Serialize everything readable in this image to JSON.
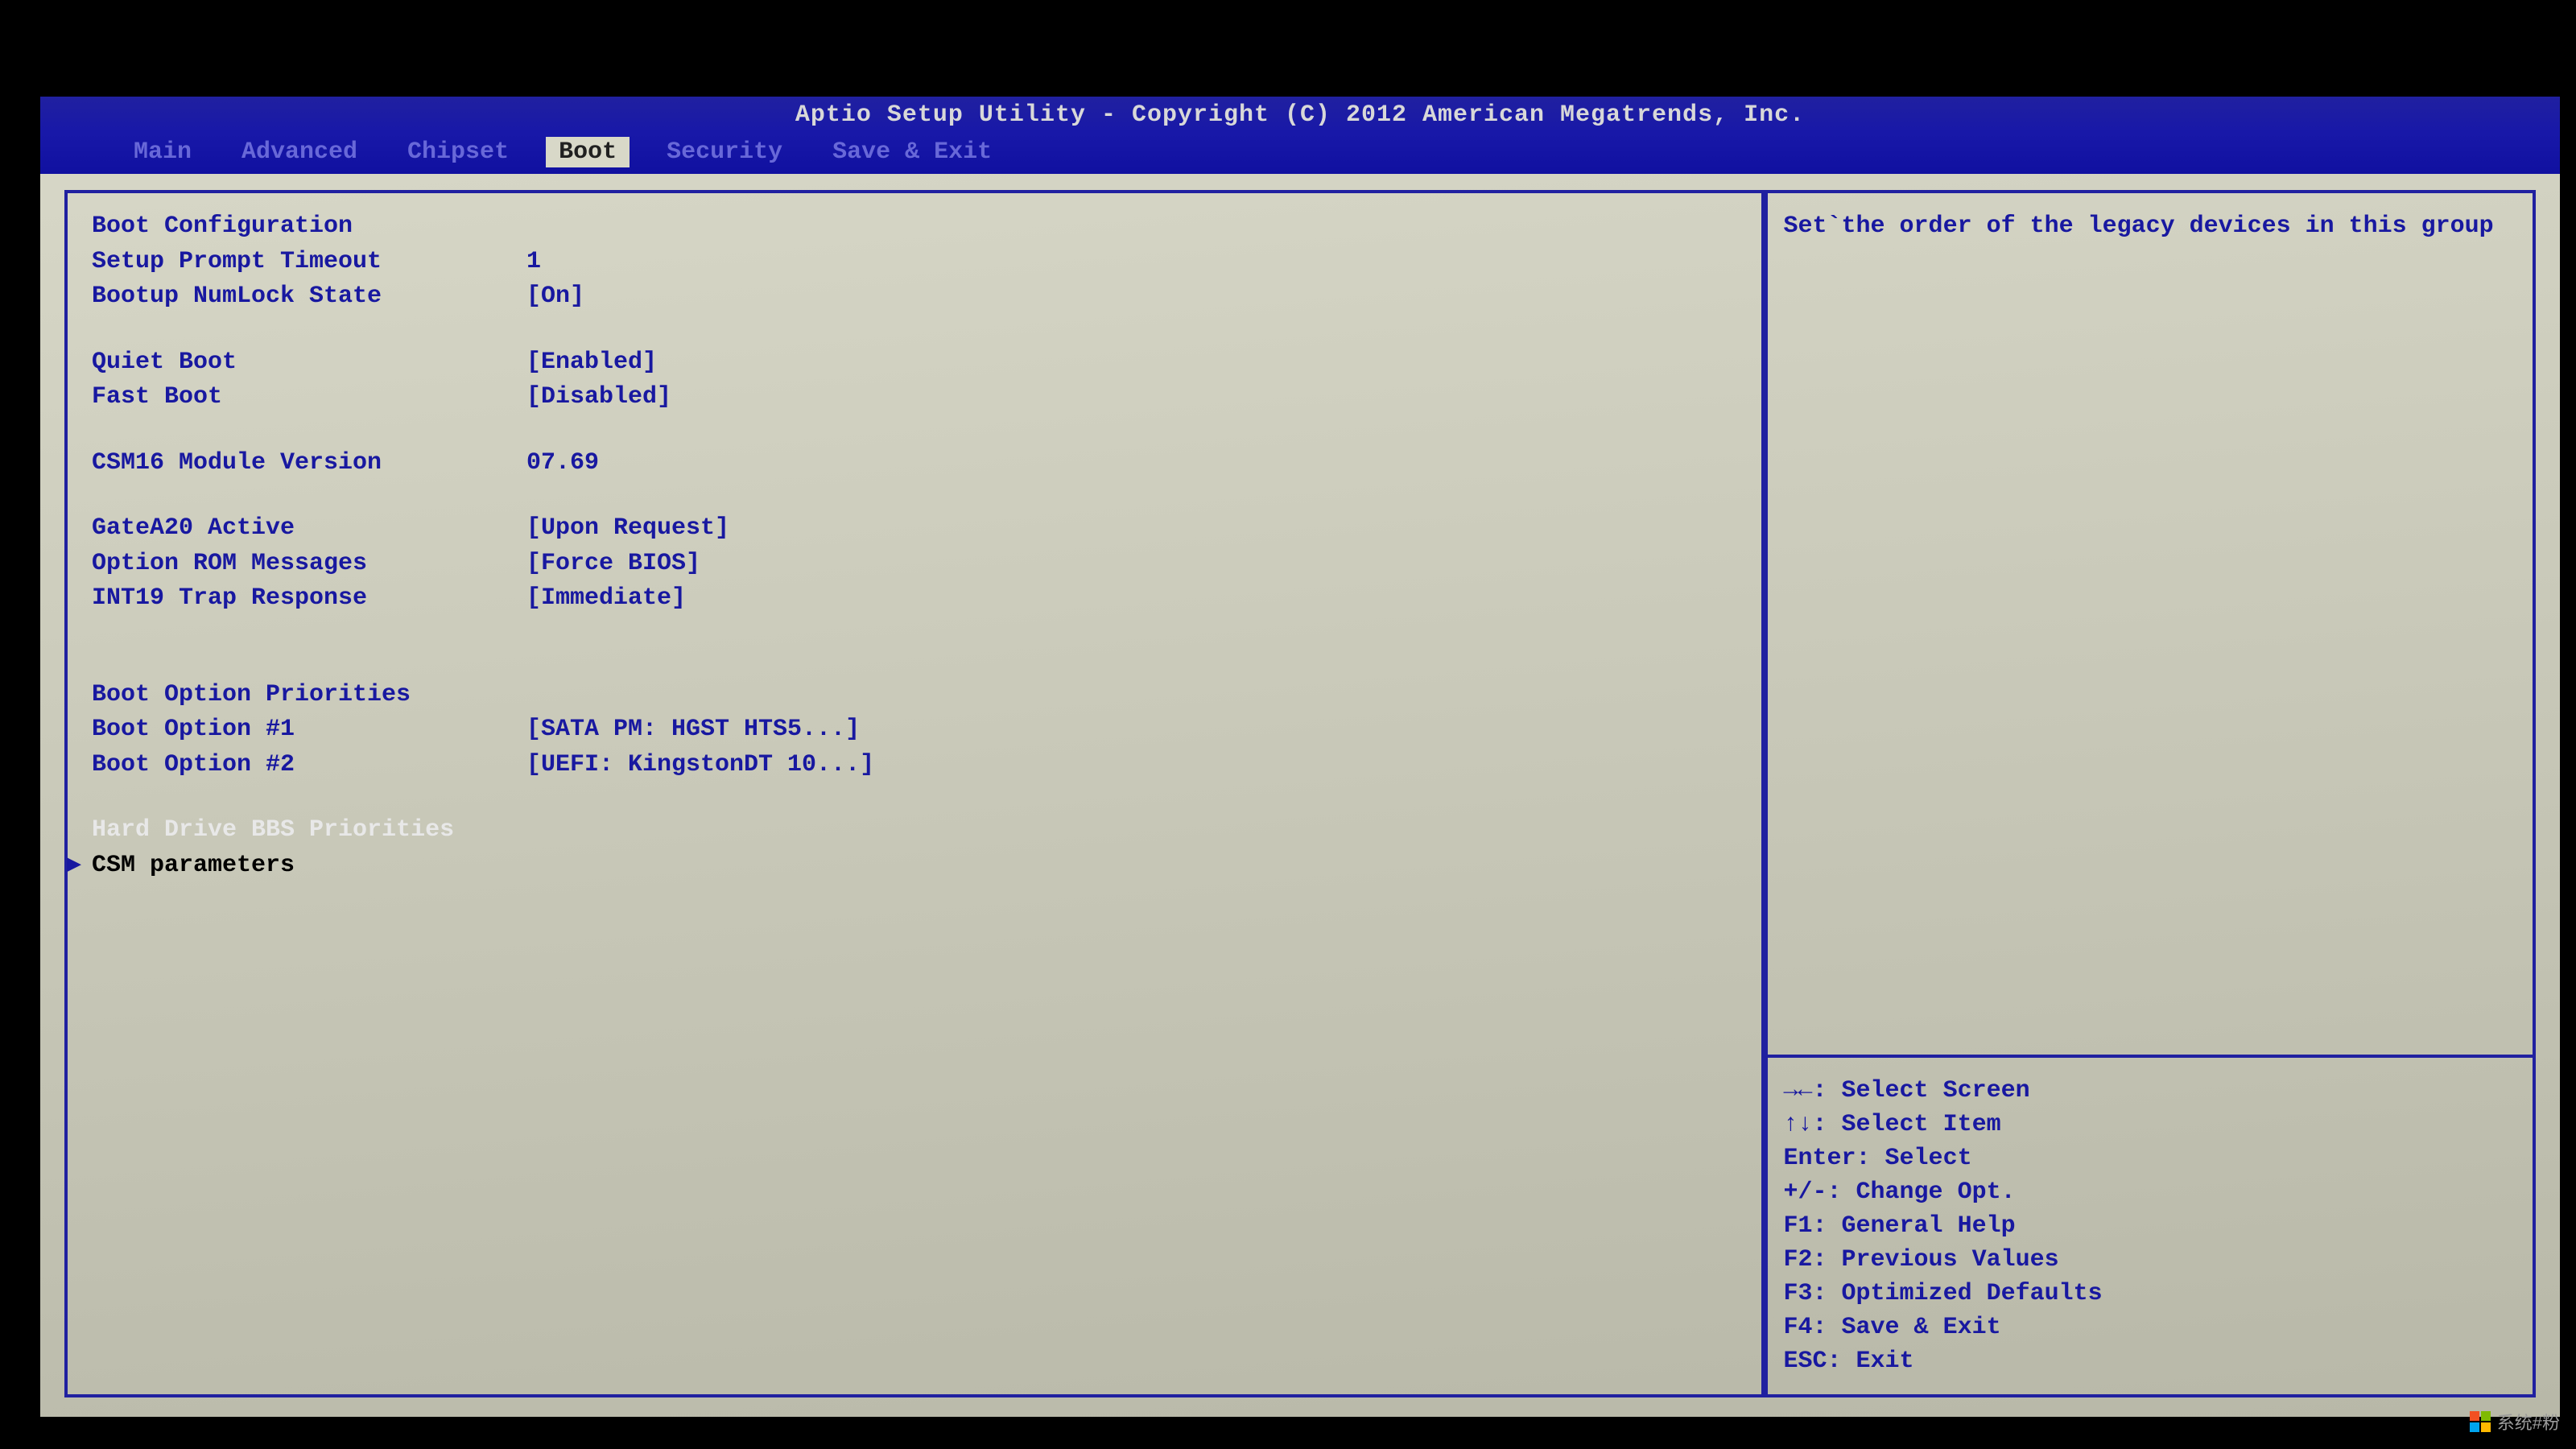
{
  "title": "Aptio Setup Utility - Copyright (C) 2012 American Megatrends, Inc.",
  "tabs": {
    "main": "Main",
    "advanced": "Advanced",
    "chipset": "Chipset",
    "boot": "Boot",
    "security": "Security",
    "save_exit": "Save & Exit"
  },
  "section": {
    "boot_config": "Boot Configuration",
    "boot_priorities": "Boot Option Priorities"
  },
  "settings": {
    "setup_prompt_timeout": {
      "label": "Setup Prompt Timeout",
      "value": "1"
    },
    "bootup_numlock": {
      "label": "Bootup NumLock State",
      "value": "[On]"
    },
    "quiet_boot": {
      "label": "Quiet Boot",
      "value": "[Enabled]"
    },
    "fast_boot": {
      "label": "Fast Boot",
      "value": "[Disabled]"
    },
    "csm16_version": {
      "label": "CSM16 Module Version",
      "value": "07.69"
    },
    "gatea20": {
      "label": "GateA20 Active",
      "value": "[Upon Request]"
    },
    "option_rom": {
      "label": "Option ROM Messages",
      "value": "[Force BIOS]"
    },
    "int19": {
      "label": "INT19 Trap Response",
      "value": "[Immediate]"
    },
    "boot_opt1": {
      "label": "Boot Option #1",
      "value": "[SATA  PM: HGST HTS5...]"
    },
    "boot_opt2": {
      "label": "Boot Option #2",
      "value": "[UEFI: KingstonDT 10...]"
    }
  },
  "submenus": {
    "hdd_bbs": "Hard Drive BBS Priorities",
    "csm_params": "CSM parameters"
  },
  "help_text": "Set`the order of the legacy devices in this group",
  "keys": {
    "select_screen": "→←: Select Screen",
    "select_item": "↑↓: Select Item",
    "enter": "Enter: Select",
    "change": "+/-: Change Opt.",
    "f1": "F1: General Help",
    "f2": "F2: Previous Values",
    "f3": "F3: Optimized Defaults",
    "f4": "F4: Save & Exit",
    "esc": "ESC: Exit"
  },
  "watermark": {
    "text": "系统#粉"
  }
}
